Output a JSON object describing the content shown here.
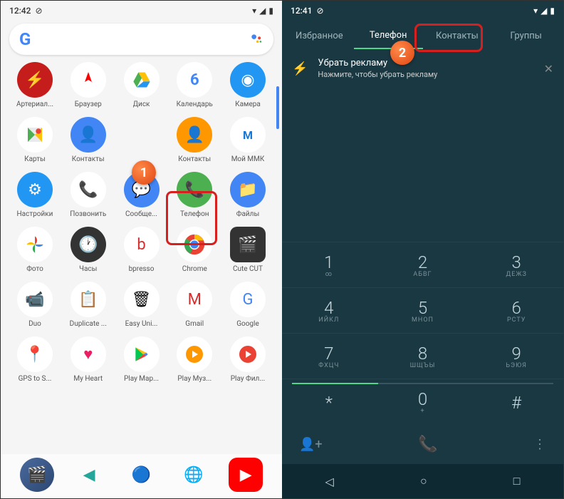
{
  "left": {
    "status": {
      "time": "12:42"
    },
    "apps": [
      [
        {
          "label": "Артериал...",
          "icon": "arterial",
          "glyph": "⚡"
        },
        {
          "label": "Браузер",
          "icon": "browser",
          "glyph": "Y"
        },
        {
          "label": "Диск",
          "icon": "disk",
          "glyph": "▲"
        },
        {
          "label": "Календарь",
          "icon": "calendar",
          "glyph": "6"
        },
        {
          "label": "Камера",
          "icon": "camera",
          "glyph": "◉"
        }
      ],
      [
        {
          "label": "Карты",
          "icon": "maps",
          "glyph": "◆"
        },
        {
          "label": "Контакты",
          "icon": "contacts",
          "glyph": "👤"
        },
        {
          "label": "",
          "icon": "",
          "glyph": ""
        },
        {
          "label": "Контакты",
          "icon": "contacts2",
          "glyph": "👤"
        },
        {
          "label": "Мой ММК",
          "icon": "mmk",
          "glyph": "M"
        }
      ],
      [
        {
          "label": "Настройки",
          "icon": "settings",
          "glyph": "⚙"
        },
        {
          "label": "Позвонить",
          "icon": "call",
          "glyph": "📞"
        },
        {
          "label": "Сообще...",
          "icon": "messages",
          "glyph": "💬"
        },
        {
          "label": "Телефон",
          "icon": "phone",
          "glyph": "📞"
        },
        {
          "label": "Файлы",
          "icon": "files",
          "glyph": "📁"
        }
      ],
      [
        {
          "label": "Фото",
          "icon": "photos",
          "glyph": "✦"
        },
        {
          "label": "Часы",
          "icon": "clock",
          "glyph": "🕐"
        },
        {
          "label": "bpresso",
          "icon": "bpresso",
          "glyph": "b"
        },
        {
          "label": "Chrome",
          "icon": "chrome",
          "glyph": "◉"
        },
        {
          "label": "Cute CUT",
          "icon": "cutecut",
          "glyph": "🎬"
        }
      ],
      [
        {
          "label": "Duo",
          "icon": "duo",
          "glyph": "📹"
        },
        {
          "label": "Duplicate ...",
          "icon": "duplicate",
          "glyph": "📋"
        },
        {
          "label": "Easy Uni...",
          "icon": "uninstall",
          "glyph": "🗑"
        },
        {
          "label": "Gmail",
          "icon": "gmail",
          "glyph": "M"
        },
        {
          "label": "Google",
          "icon": "google",
          "glyph": "G"
        }
      ],
      [
        {
          "label": "GPS to S...",
          "icon": "gps",
          "glyph": "📍"
        },
        {
          "label": "My Heart",
          "icon": "heart",
          "glyph": "♥"
        },
        {
          "label": "Play Мар...",
          "icon": "play1",
          "glyph": "▶"
        },
        {
          "label": "Play Муз...",
          "icon": "play2",
          "glyph": "▶"
        },
        {
          "label": "Play Фил...",
          "icon": "play3",
          "glyph": "▶"
        }
      ]
    ]
  },
  "right": {
    "status": {
      "time": "12:41"
    },
    "tabs": [
      "Избранное",
      "Телефон",
      "Контакты",
      "Группы"
    ],
    "activeTab": 1,
    "ad": {
      "title": "Убрать рекламу",
      "subtitle": "Нажмите, чтобы убрать рекламу"
    },
    "dialpad": [
      {
        "num": "1",
        "letters": "∞"
      },
      {
        "num": "2",
        "letters": "АБВГ"
      },
      {
        "num": "3",
        "letters": "ДЕЖЗ"
      },
      {
        "num": "4",
        "letters": "ИЙКЛ"
      },
      {
        "num": "5",
        "letters": "МНОП"
      },
      {
        "num": "6",
        "letters": "РСТУ"
      },
      {
        "num": "7",
        "letters": "ФХЦЧ"
      },
      {
        "num": "8",
        "letters": "ШЩЪЫ"
      },
      {
        "num": "9",
        "letters": "ЬЭЮЯ"
      },
      {
        "num": "*",
        "letters": ""
      },
      {
        "num": "0",
        "letters": "+"
      },
      {
        "num": "#",
        "letters": ""
      }
    ]
  },
  "steps": {
    "one": "1",
    "two": "2"
  }
}
